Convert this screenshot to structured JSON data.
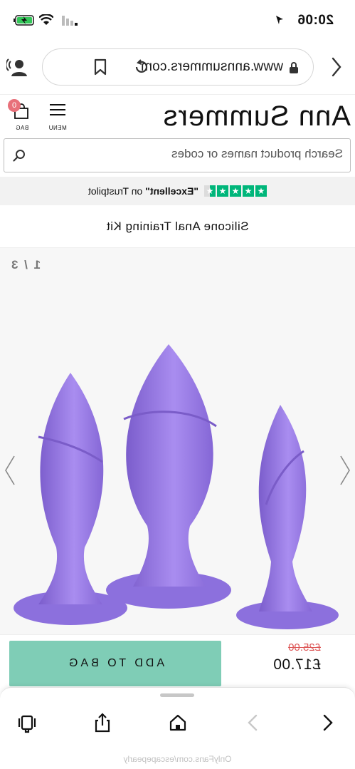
{
  "status_bar": {
    "time": "20:06"
  },
  "browser": {
    "url": "www.annsummers.com"
  },
  "site": {
    "logo": "Ann Summers",
    "menu_label": "MENU",
    "bag_label": "BAG",
    "bag_count": "0"
  },
  "search": {
    "placeholder": "Search product names or codes"
  },
  "trustpilot": {
    "rating_word": "\"Excellent\"",
    "suffix": "on Trustpilot",
    "stars": 4.5
  },
  "product": {
    "title": "Silicone Anal Training Kit",
    "image_counter": "1 / 3",
    "old_price": "£25.00",
    "price": "£17.00",
    "add_to_bag_label": "ADD TO BAG"
  },
  "colors": {
    "accent_button": "#7fcdb6",
    "badge": "#e8707a",
    "trustpilot_green": "#00b67a",
    "product_purple": "#9b7fe0"
  },
  "watermark": "OnlyFans.com/escapepearly"
}
